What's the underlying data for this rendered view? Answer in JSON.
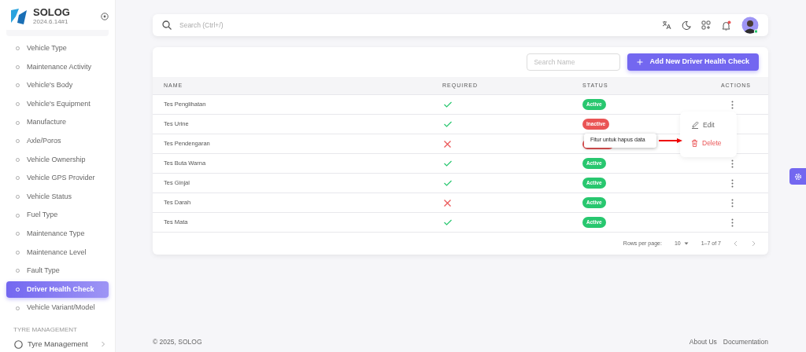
{
  "brand": {
    "name": "SOLOG",
    "version": "2024.6.14#1"
  },
  "sidebar": {
    "items": [
      {
        "label": "Vehicle Type",
        "selected": false
      },
      {
        "label": "Maintenance Activity",
        "selected": false
      },
      {
        "label": "Vehicle's Body",
        "selected": false
      },
      {
        "label": "Vehicle's Equipment",
        "selected": false
      },
      {
        "label": "Manufacture",
        "selected": false
      },
      {
        "label": "Axle/Poros",
        "selected": false
      },
      {
        "label": "Vehicle Ownership",
        "selected": false
      },
      {
        "label": "Vehicle GPS Provider",
        "selected": false
      },
      {
        "label": "Vehicle Status",
        "selected": false
      },
      {
        "label": "Fuel Type",
        "selected": false
      },
      {
        "label": "Maintenance Type",
        "selected": false
      },
      {
        "label": "Maintenance Level",
        "selected": false
      },
      {
        "label": "Fault Type",
        "selected": false
      },
      {
        "label": "Driver Health Check",
        "selected": true
      },
      {
        "label": "Vehicle Variant/Model",
        "selected": false
      }
    ],
    "section": "TYRE MANAGEMENT",
    "group": "Tyre Management"
  },
  "search": {
    "placeholder": "Search (Ctrl+/)"
  },
  "toolbar": {
    "search_placeholder": "Search Name",
    "add_button": "Add New Driver Health Check"
  },
  "table": {
    "columns": [
      "NAME",
      "REQUIRED",
      "STATUS",
      "ACTIONS"
    ],
    "rows": [
      {
        "name": "Tes Penglihatan",
        "required": true,
        "active": true,
        "status": "Active",
        "kebab": true
      },
      {
        "name": "Tes Urine",
        "required": true,
        "active": false,
        "status": "Inactive",
        "kebab": false
      },
      {
        "name": "Tes Pendengaran",
        "required": false,
        "active": false,
        "kebab": false
      },
      {
        "name": "Tes Buta Warna",
        "required": true,
        "active": true,
        "status": "Active",
        "kebab": true
      },
      {
        "name": "Tes Ginjal",
        "required": true,
        "active": true,
        "status": "Active",
        "kebab": true
      },
      {
        "name": "Tes Darah",
        "required": false,
        "active": true,
        "status": "Active",
        "kebab": true
      },
      {
        "name": "Tes Mata",
        "required": true,
        "active": true,
        "status": "Active",
        "kebab": true
      }
    ]
  },
  "menu": {
    "items": [
      {
        "label": "Edit",
        "kind": "edit"
      },
      {
        "label": "Delete",
        "kind": "delete"
      }
    ]
  },
  "tooltip": "Fitur untuk hapus data",
  "pagination": {
    "rows_label": "Rows per page:",
    "rows_value": "10",
    "range": "1–7 of 7"
  },
  "footer": {
    "copyright": "© 2025, SOLOG",
    "links": [
      "About Us",
      "Documentation"
    ]
  }
}
